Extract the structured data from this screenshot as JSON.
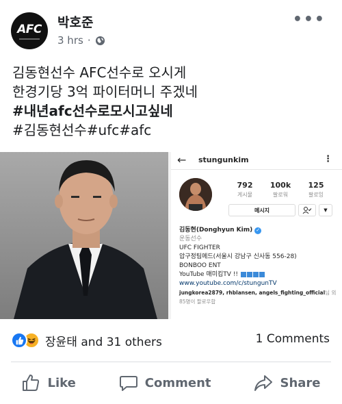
{
  "post": {
    "author": "박호준",
    "time": "3 hrs",
    "avatar_logo": "AFC",
    "lines": [
      {
        "text": "김동현선수 AFC선수로 오시게",
        "bold": false
      },
      {
        "text": "한경기당 3억 파이터머니 주겠네",
        "bold": false
      },
      {
        "text": "#내년afc선수로모시고싶네",
        "bold": true
      },
      {
        "text": "#김동현선수#ufc#afc",
        "bold": false
      }
    ]
  },
  "instagram": {
    "username": "stungunkim",
    "stats": [
      {
        "num": "792",
        "label": "게시물"
      },
      {
        "num": "100k",
        "label": "팔로워"
      },
      {
        "num": "125",
        "label": "팔로잉"
      }
    ],
    "message_button": "메시지",
    "bio": {
      "name": "김동현(Donghyun Kim)",
      "category": "운동선수",
      "line1": "UFC FIGHTER",
      "line2": "압구정팀메드(서울시 강남구 신사동 556-28)",
      "line3": "BONBOO ENT",
      "line4": "YouTube 매미킴TV !!",
      "link": "www.youtube.com/c/stungunTV",
      "followers_names": "jungkorea2879, rhblansen, angels_fighting_official",
      "followers_suffix": "님 외",
      "followers_more": "85명이 팔로우합"
    }
  },
  "reactions": {
    "text": "장윤태 and 31 others",
    "comments": "1 Comments"
  },
  "actions": {
    "like": "Like",
    "comment": "Comment",
    "share": "Share"
  },
  "colors": {
    "facebook_blue": "#1877f2",
    "secondary_text": "#606770",
    "haha_yellow": "#f7b125"
  }
}
